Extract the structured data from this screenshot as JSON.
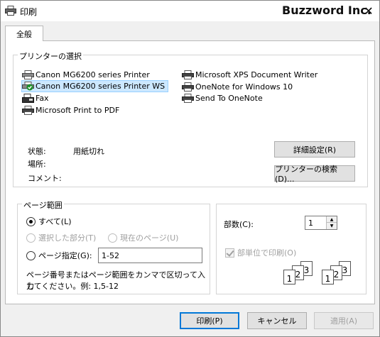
{
  "window": {
    "title": "印刷",
    "brand": "Buzzword Inc.",
    "close_glyph": "✕"
  },
  "tab": {
    "label": "全般"
  },
  "printer_group": {
    "legend": "プリンターの選択",
    "printers": [
      {
        "name": "Canon MG6200 series Printer",
        "icon": "printer-icon"
      },
      {
        "name": "Canon MG6200 series Printer WS",
        "icon": "printer-default-icon",
        "selected": true
      },
      {
        "name": "Fax",
        "icon": "fax-icon"
      },
      {
        "name": "Microsoft Print to PDF",
        "icon": "printer-icon"
      },
      {
        "name": "Microsoft XPS Document Writer",
        "icon": "printer-icon"
      },
      {
        "name": "OneNote for Windows 10",
        "icon": "printer-icon"
      },
      {
        "name": "Send To OneNote",
        "icon": "printer-icon"
      }
    ],
    "status_label": "状態:",
    "status_value": "用紙切れ",
    "location_label": "場所:",
    "comment_label": "コメント:",
    "preferences_button": "詳細設定(R)",
    "find_printer_button": "プリンターの検索(D)..."
  },
  "page_range": {
    "legend": "ページ範囲",
    "all": "すべて(L)",
    "selection": "選択した部分(T)",
    "current_page": "現在のページ(U)",
    "pages": "ページ指定(G):",
    "pages_value": "1-52",
    "hint_line1": "ページ番号またはページ範囲をカンマで区切って入力",
    "hint_line2": "してください。例: 1,5-12"
  },
  "copies": {
    "label": "部数(C):",
    "value": "1",
    "collate_label": "部単位で印刷(O)",
    "page_numbers": [
      "1",
      "2",
      "3"
    ]
  },
  "footer": {
    "print_button": "印刷(P)",
    "cancel_button": "キャンセル",
    "apply_button": "適用(A)"
  },
  "colors": {
    "selection_bg": "#cce8ff",
    "primary_border": "#0078d7",
    "default_check": "#1a8f2a"
  }
}
